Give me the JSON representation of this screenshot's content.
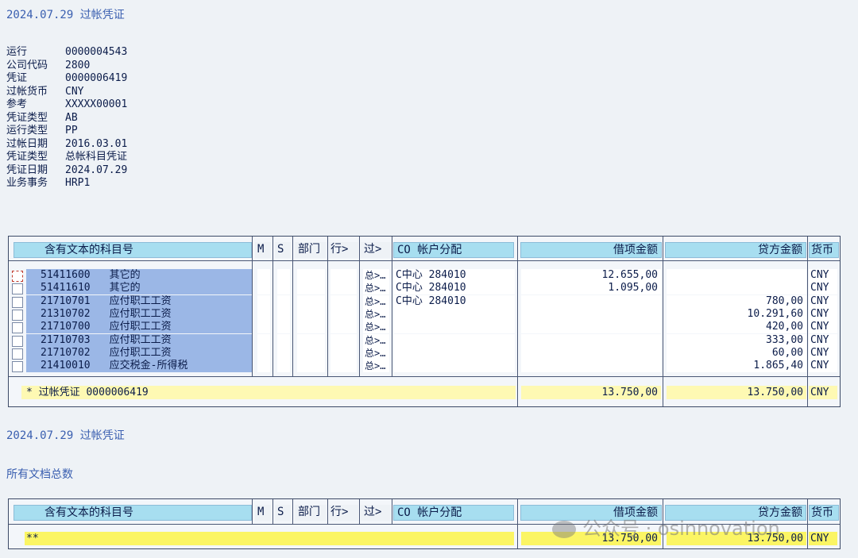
{
  "title1": "2024.07.29 过帐凭证",
  "header_fields": [
    {
      "label": "运行",
      "value": "0000004543"
    },
    {
      "label": "公司代码",
      "value": "2800"
    },
    {
      "label": "凭证",
      "value": "0000006419"
    },
    {
      "label": "过帐货币",
      "value": "CNY"
    },
    {
      "label": "参考",
      "value": "XXXXX00001"
    },
    {
      "label": "凭证类型",
      "value": "AB"
    },
    {
      "label": "运行类型",
      "value": "PP"
    },
    {
      "label": "过帐日期",
      "value": "2016.03.01"
    },
    {
      "label": "凭证类型",
      "value": "总帐科目凭证"
    },
    {
      "label": "凭证日期",
      "value": "2024.07.29"
    },
    {
      "label": "业务事务",
      "value": "HRP1"
    }
  ],
  "columns": {
    "acct": "含有文本的科目号",
    "m": "M",
    "s": "S",
    "dept": "部门",
    "line": "行>",
    "post": "过>",
    "co": "CO 帐户分配",
    "debit": "借项金额",
    "credit": "贷方金额",
    "cur": "币"
  },
  "columns_cur_full": "货币",
  "rows": [
    {
      "acct": "51411600",
      "text": "其它的",
      "post": "总>…",
      "co": "C中心 284010",
      "debit": "12.655,00",
      "credit": "",
      "cur": "CNY"
    },
    {
      "acct": "51411610",
      "text": "其它的",
      "post": "总>…",
      "co": "C中心 284010",
      "debit": "1.095,00",
      "credit": "",
      "cur": "CNY"
    },
    {
      "acct": "21710701",
      "text": "应付职工工资",
      "post": "总>…",
      "co": "C中心 284010",
      "debit": "",
      "credit": "780,00",
      "cur": "CNY"
    },
    {
      "acct": "21310702",
      "text": "应付职工工资",
      "post": "总>…",
      "co": "",
      "debit": "",
      "credit": "10.291,60",
      "cur": "CNY"
    },
    {
      "acct": "21710700",
      "text": "应付职工工资",
      "post": "总>…",
      "co": "",
      "debit": "",
      "credit": "420,00",
      "cur": "CNY"
    },
    {
      "acct": "21710703",
      "text": "应付职工工资",
      "post": "总>…",
      "co": "",
      "debit": "",
      "credit": "333,00",
      "cur": "CNY"
    },
    {
      "acct": "21710702",
      "text": "应付职工工资",
      "post": "总>…",
      "co": "",
      "debit": "",
      "credit": "60,00",
      "cur": "CNY"
    },
    {
      "acct": "21410010",
      "text": "应交税金-所得税",
      "post": "总>…",
      "co": "",
      "debit": "",
      "credit": "1.865,40",
      "cur": "CNY"
    }
  ],
  "subtotal": {
    "label": "* 过帐凭证 0000006419",
    "debit": "13.750,00",
    "credit": "13.750,00",
    "cur": "CNY"
  },
  "title2": "2024.07.29 过帐凭证",
  "title3": "所有文档总数",
  "total": {
    "label": "**",
    "debit": "13.750,00",
    "credit": "13.750,00",
    "cur": "CNY"
  },
  "watermark": "公众号 · osinnovation"
}
